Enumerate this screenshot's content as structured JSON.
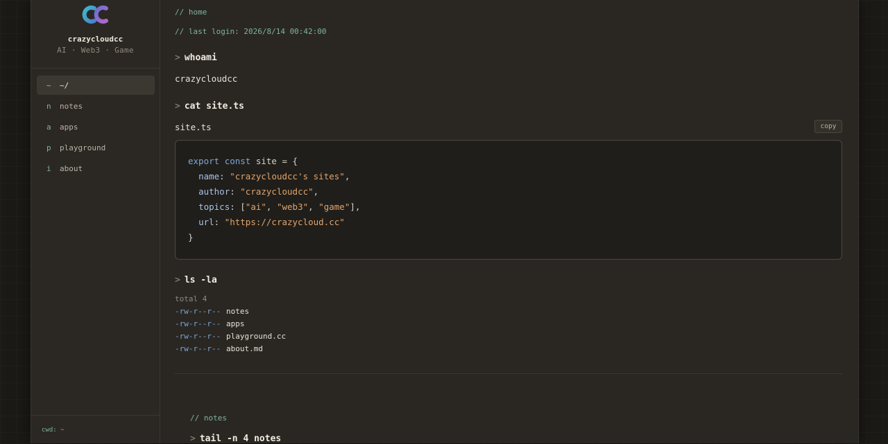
{
  "sidebar": {
    "brand_name": "crazycloudcc",
    "brand_tagline": "AI · Web3 · Game",
    "logo_icon": "cc-logo-icon",
    "nav": [
      {
        "key": "~",
        "label": "~/",
        "active": true
      },
      {
        "key": "n",
        "label": "notes",
        "active": false
      },
      {
        "key": "a",
        "label": "apps",
        "active": false
      },
      {
        "key": "p",
        "label": "playground",
        "active": false
      },
      {
        "key": "i",
        "label": "about",
        "active": false
      }
    ],
    "cwd": "cwd: ~"
  },
  "main": {
    "page_comment": "// home",
    "last_login": "// last login: 2026/8/14 00:42:00",
    "prompt": ">",
    "whoami": {
      "command": "whoami",
      "output": "crazycloudcc"
    },
    "cat": {
      "command": "cat site.ts",
      "filename": "site.ts",
      "copy_label": "copy",
      "code": {
        "l1": {
          "kw1": "export",
          "kw2": "const",
          "var": "site",
          "rest": " = {"
        },
        "l2": {
          "prop": "name",
          "str": "\"crazycloudcc's sites\"",
          "tail": ","
        },
        "l3": {
          "prop": "author",
          "str": "\"crazycloudcc\"",
          "tail": ","
        },
        "l4": {
          "prop": "topics",
          "s1": "\"ai\"",
          "s2": "\"web3\"",
          "s3": "\"game\"",
          "tail": "],"
        },
        "l5": {
          "prop": "url",
          "str": "\"https://crazycloud.cc\""
        },
        "l6": "}"
      }
    },
    "ls": {
      "command": "ls -la",
      "total": "total 4",
      "rows": [
        {
          "perm": "-rw-r--r--",
          "name": "notes"
        },
        {
          "perm": "-rw-r--r--",
          "name": "apps"
        },
        {
          "perm": "-rw-r--r--",
          "name": "playground.cc"
        },
        {
          "perm": "-rw-r--r--",
          "name": "about.md"
        }
      ]
    },
    "notes_comment": "// notes",
    "tail": {
      "command": "tail -n 4 notes"
    }
  },
  "colors": {
    "accent_green": "#7fb3a0",
    "accent_blue": "#7fa6d6",
    "string_orange": "#e0a46e",
    "panel_bg": "#2a2722"
  }
}
